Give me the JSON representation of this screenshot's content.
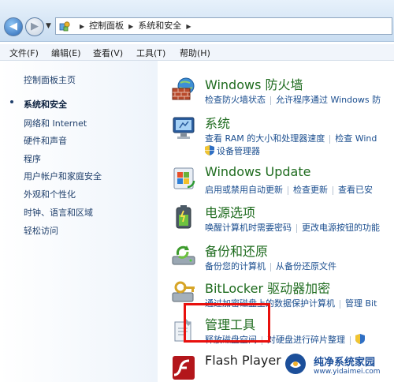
{
  "address_bar": {
    "breadcrumbs": [
      "控制面板",
      "系统和安全"
    ]
  },
  "menu": {
    "items": [
      "文件(F)",
      "编辑(E)",
      "查看(V)",
      "工具(T)",
      "帮助(H)"
    ]
  },
  "left_pane": {
    "links": [
      "控制面板主页",
      "系统和安全",
      "网络和 Internet",
      "硬件和声音",
      "程序",
      "用户帐户和家庭安全",
      "外观和个性化",
      "时钟、语言和区域",
      "轻松访问"
    ]
  },
  "categories": [
    {
      "title": "Windows 防火墙",
      "icon": "firewall-icon",
      "links": [
        "检查防火墙状态",
        "允许程序通过 Windows 防"
      ]
    },
    {
      "title": "系统",
      "icon": "system-icon",
      "links": [
        "查看 RAM 的大小和处理器速度",
        "检查 Wind"
      ],
      "links2": [
        "设备管理器"
      ]
    },
    {
      "title": "Windows Update",
      "icon": "windows-update-icon",
      "links": [
        "启用或禁用自动更新",
        "检查更新",
        "查看已安"
      ]
    },
    {
      "title": "电源选项",
      "icon": "power-options-icon",
      "links": [
        "唤醒计算机时需要密码",
        "更改电源按钮的功能"
      ]
    },
    {
      "title": "备份和还原",
      "icon": "backup-restore-icon",
      "links": [
        "备份您的计算机",
        "从备份还原文件"
      ]
    },
    {
      "title": "BitLocker 驱动器加密",
      "icon": "bitlocker-icon",
      "links": [
        "通过加密磁盘上的数据保护计算机",
        "管理 Bit"
      ]
    },
    {
      "title": "管理工具",
      "icon": "admin-tools-icon",
      "links": [
        "释放磁盘空间",
        "对硬盘进行碎片整理"
      ]
    },
    {
      "title": "Flash Player",
      "icon": "flash-player-icon",
      "links": []
    }
  ],
  "watermark": {
    "name": "纯净系统家园",
    "url": "www.yidaimei.com"
  },
  "colors": {
    "title_green": "#1e6b1e",
    "link_blue": "#1b4e8f",
    "highlight_red": "#e8100d"
  }
}
